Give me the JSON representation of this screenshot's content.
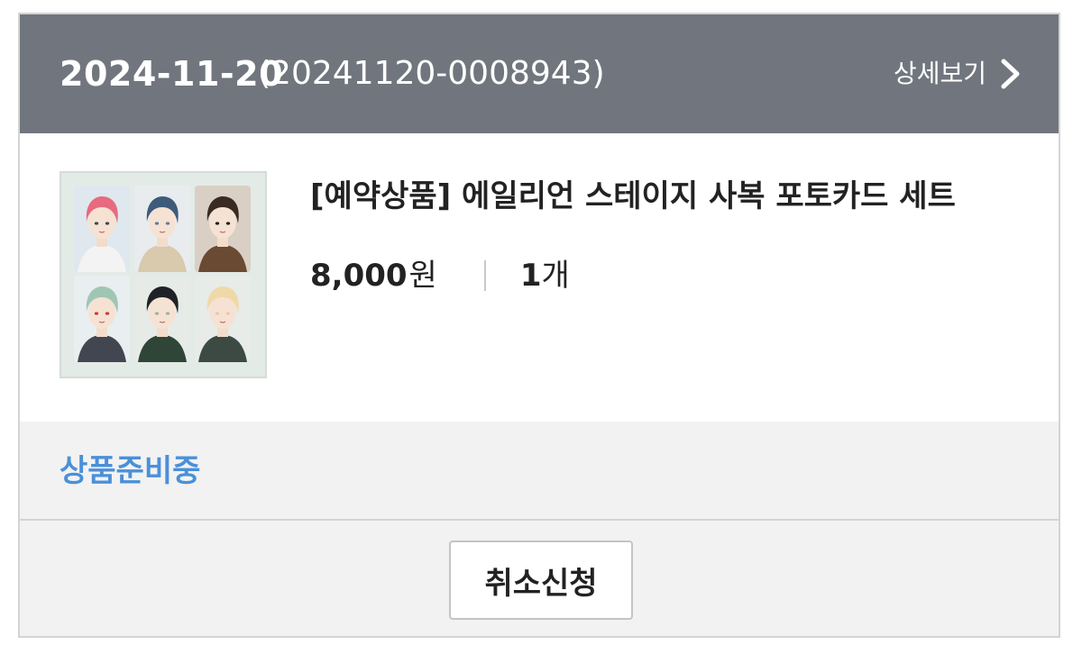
{
  "order": {
    "date": "2024-11-20",
    "number": "(20241120-0008943)",
    "detail_label": "상세보기",
    "detail_icon": "chevron-right-icon"
  },
  "product": {
    "name": "[예약상품] 에일리언 스테이지 사복 포토카드 세트",
    "price": "8,000",
    "price_unit": "원",
    "quantity": "1",
    "quantity_unit": "개",
    "thumbnail_cards": [
      {
        "hair": "#e86a7e",
        "bg": "#dfe8ee",
        "shirt": "#f3f3f3",
        "accent": "#3b4a5c"
      },
      {
        "hair": "#3f5b7a",
        "bg": "#e8ecef",
        "shirt": "#d9c9ad",
        "accent": "#5d7ea3"
      },
      {
        "hair": "#3a2a22",
        "bg": "#d9cfc5",
        "shirt": "#6b4a33",
        "accent": "#222222"
      },
      {
        "hair": "#9fc6b4",
        "bg": "#e9eef0",
        "shirt": "#414651",
        "accent": "#c73a3a"
      },
      {
        "hair": "#1f2328",
        "bg": "#e6ebe8",
        "shirt": "#2f4538",
        "accent": "#9ab3a2"
      },
      {
        "hair": "#f0d9a8",
        "bg": "#e7ece9",
        "shirt": "#3d4a44",
        "accent": "#e9c9b2"
      }
    ]
  },
  "status": {
    "text": "상품준비중",
    "color": "#4a90d9"
  },
  "actions": {
    "cancel_label": "취소신청"
  },
  "colors": {
    "header_bg": "#71767e",
    "panel_bg": "#f2f2f2",
    "border": "#d4d4d4"
  }
}
